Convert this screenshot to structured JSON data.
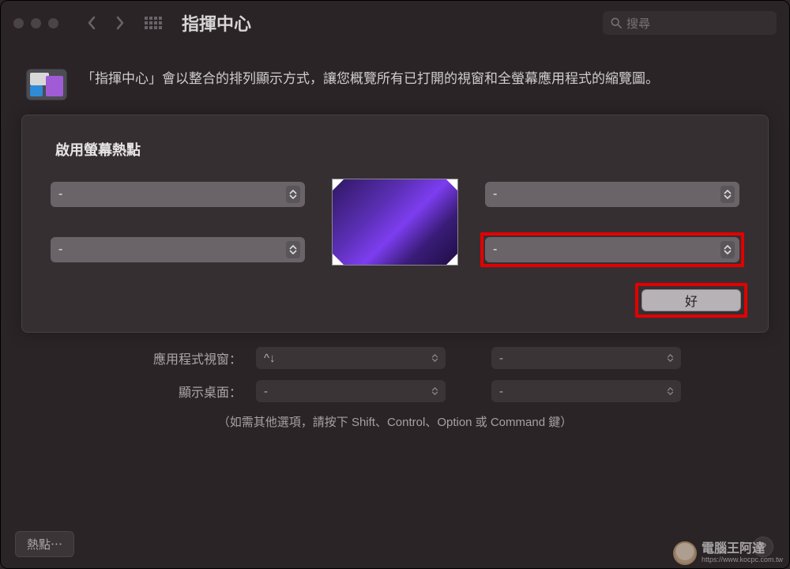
{
  "toolbar": {
    "title": "指揮中心",
    "search_placeholder": "搜尋"
  },
  "description": "「指揮中心」會以整合的排列顯示方式，讓您概覽所有已打開的視窗和全螢幕應用程式的縮覽圖。",
  "modal": {
    "title": "啟用螢幕熱點",
    "corners": {
      "top_left": "-",
      "top_right": "-",
      "bottom_left": "-",
      "bottom_right": "-"
    },
    "ok_label": "好"
  },
  "lower": {
    "rows": [
      {
        "label": "應用程式視窗：",
        "value1": "^↓",
        "value2": "-"
      },
      {
        "label": "顯示桌面：",
        "value1": "-",
        "value2": "-"
      }
    ],
    "hint": "（如需其他選項，請按下 Shift、Control、Option 或 Command 鍵）"
  },
  "footer": {
    "hotspot_button": "熱點⋯"
  },
  "watermark": {
    "line1": "電腦王阿達",
    "line2": "https://www.kocpc.com.tw"
  }
}
